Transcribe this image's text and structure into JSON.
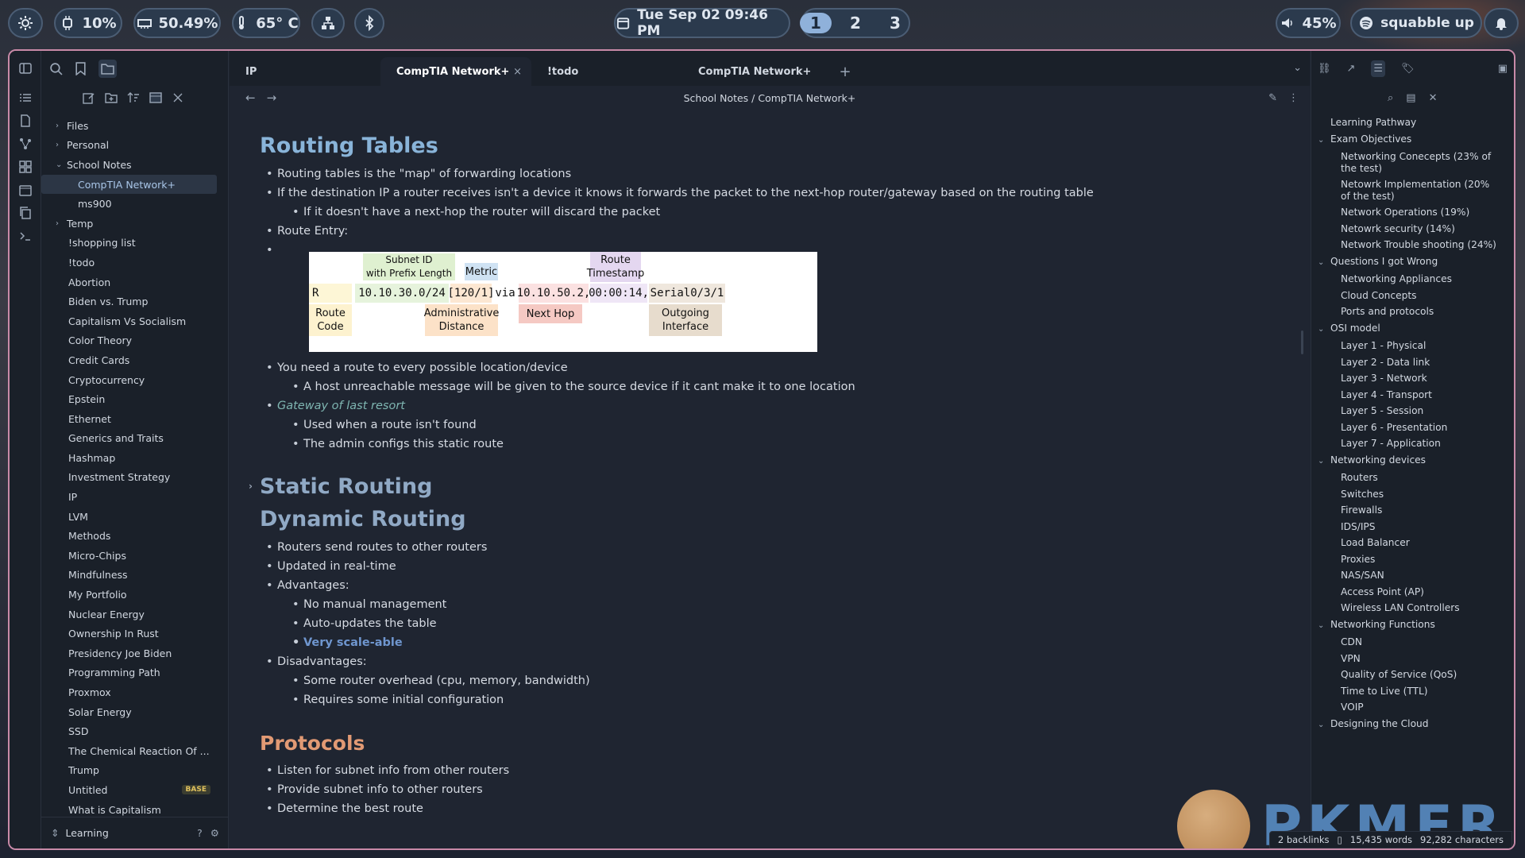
{
  "topbar": {
    "cpu": "10%",
    "memory": "50.49%",
    "temp": "65° C",
    "datetime": "Tue Sep 02  09:46 PM",
    "workspaces": [
      "1",
      "2",
      "3"
    ],
    "volume": "45%",
    "music": "squabble up"
  },
  "tabs": [
    {
      "label": "IP"
    },
    {
      "label": "CompTIA Network+",
      "close": "×"
    },
    {
      "label": "!todo"
    },
    {
      "label": "CompTIA Network+"
    }
  ],
  "breadcrumb": "School Notes / CompTIA Network+",
  "filetree": [
    {
      "label": "Files",
      "type": "folder",
      "chevron": "›"
    },
    {
      "label": "Personal",
      "type": "folder",
      "chevron": "›"
    },
    {
      "label": "School Notes",
      "type": "folder",
      "chevron": "⌄"
    },
    {
      "label": "CompTIA Network+",
      "type": "child-active"
    },
    {
      "label": "ms900",
      "type": "child"
    },
    {
      "label": "Temp",
      "type": "folder",
      "chevron": "›"
    },
    {
      "label": "!shopping list"
    },
    {
      "label": "!todo"
    },
    {
      "label": "Abortion"
    },
    {
      "label": "Biden vs. Trump"
    },
    {
      "label": "Capitalism Vs Socialism"
    },
    {
      "label": "Color Theory"
    },
    {
      "label": "Credit Cards"
    },
    {
      "label": "Cryptocurrency"
    },
    {
      "label": "Epstein"
    },
    {
      "label": "Ethernet"
    },
    {
      "label": "Generics and Traits"
    },
    {
      "label": "Hashmap"
    },
    {
      "label": "Investment Strategy"
    },
    {
      "label": "IP"
    },
    {
      "label": "LVM"
    },
    {
      "label": "Methods"
    },
    {
      "label": "Micro-Chips"
    },
    {
      "label": "Mindfulness"
    },
    {
      "label": "My Portfolio"
    },
    {
      "label": "Nuclear Energy"
    },
    {
      "label": "Ownership In Rust"
    },
    {
      "label": "Presidency Joe Biden"
    },
    {
      "label": "Programming Path"
    },
    {
      "label": "Proxmox"
    },
    {
      "label": "Solar Energy"
    },
    {
      "label": "SSD"
    },
    {
      "label": "The Chemical Reaction Of ..."
    },
    {
      "label": "Trump"
    },
    {
      "label": "Untitled",
      "badge": "BASE"
    },
    {
      "label": "What is Capitalism"
    }
  ],
  "vault": "Learning",
  "note": {
    "h_routing": "Routing Tables",
    "routing": [
      {
        "t": "Routing tables is the \"map\" of forwarding locations",
        "l": 1
      },
      {
        "t": "If the destination IP a router receives isn't a device it knows it forwards the packet to the next-hop router/gateway based on the routing table",
        "l": 1
      },
      {
        "t": "If it doesn't have a next-hop the router will discard the packet",
        "l": 2
      },
      {
        "t": "Route Entry:",
        "l": 1
      }
    ],
    "route_entry": {
      "subnet_label": "Subnet ID\nwith Prefix Length",
      "metric_label": "Metric",
      "timestamp_label": "Route\nTimestamp",
      "code": "R",
      "subnet": "10.10.30.0/24",
      "admin": "[120/1]",
      "via": "via",
      "nexthop": "10.10.50.2,",
      "time": "00:00:14,",
      "iface": "Serial0/3/1",
      "route_code_label": "Route\nCode",
      "admin_label": "Administrative\nDistance",
      "nexthop_label": "Next Hop",
      "iface_label": "Outgoing\nInterface"
    },
    "routing2": [
      {
        "t": "You need a route to every possible location/device",
        "l": 1
      },
      {
        "t": "A host unreachable message will be given to the source device if it cant make it to one location",
        "l": 2
      },
      {
        "t": "Gateway of last resort",
        "l": 1,
        "s": "italic"
      },
      {
        "t": "Used when a route isn't found",
        "l": 2
      },
      {
        "t": "The admin configs this static route",
        "l": 2
      }
    ],
    "h_static": "Static Routing",
    "h_dynamic": "Dynamic Routing",
    "dynamic": [
      {
        "t": "Routers send routes to other routers",
        "l": 1
      },
      {
        "t": "Updated in real-time",
        "l": 1
      },
      {
        "t": "Advantages:",
        "l": 1
      },
      {
        "t": "No manual management",
        "l": 2
      },
      {
        "t": "Auto-updates the table",
        "l": 2
      },
      {
        "t": "Very scale-able",
        "l": 2,
        "s": "bold-link"
      },
      {
        "t": "Disadvantages:",
        "l": 1
      },
      {
        "t": "Some router overhead (cpu, memory, bandwidth)",
        "l": 2
      },
      {
        "t": "Requires some initial configuration",
        "l": 2
      }
    ],
    "h_protocols": "Protocols",
    "protocols": [
      {
        "t": "Listen for subnet info from other routers",
        "l": 1
      },
      {
        "t": "Provide subnet info to other routers",
        "l": 1
      },
      {
        "t": "Determine the best route",
        "l": 1
      }
    ]
  },
  "outline": [
    {
      "t": "Learning Pathway",
      "k": "top"
    },
    {
      "t": "Exam Objectives",
      "k": "h"
    },
    {
      "t": "Networking Conecepts (23% of the test)",
      "k": "sub"
    },
    {
      "t": "Netowrk Implementation (20% of the test)",
      "k": "sub"
    },
    {
      "t": "Network Operations (19%)",
      "k": "sub"
    },
    {
      "t": "Netowrk security (14%)",
      "k": "sub"
    },
    {
      "t": "Network Trouble shooting (24%)",
      "k": "sub"
    },
    {
      "t": "Questions I got Wrong",
      "k": "h"
    },
    {
      "t": "Networking Appliances",
      "k": "sub"
    },
    {
      "t": "Cloud Concepts",
      "k": "sub"
    },
    {
      "t": "Ports and protocols",
      "k": "sub"
    },
    {
      "t": "OSI model",
      "k": "h"
    },
    {
      "t": "Layer 1 - Physical",
      "k": "sub"
    },
    {
      "t": "Layer 2 - Data link",
      "k": "sub"
    },
    {
      "t": "Layer 3 - Network",
      "k": "sub"
    },
    {
      "t": "Layer 4 - Transport",
      "k": "sub"
    },
    {
      "t": "Layer 5 - Session",
      "k": "sub"
    },
    {
      "t": "Layer 6 - Presentation",
      "k": "sub"
    },
    {
      "t": "Layer 7 - Application",
      "k": "sub"
    },
    {
      "t": "Networking devices",
      "k": "h"
    },
    {
      "t": "Routers",
      "k": "sub"
    },
    {
      "t": "Switches",
      "k": "sub"
    },
    {
      "t": "Firewalls",
      "k": "sub"
    },
    {
      "t": "IDS/IPS",
      "k": "sub"
    },
    {
      "t": "Load Balancer",
      "k": "sub"
    },
    {
      "t": "Proxies",
      "k": "sub"
    },
    {
      "t": "NAS/SAN",
      "k": "sub"
    },
    {
      "t": "Access Point (AP)",
      "k": "sub"
    },
    {
      "t": "Wireless LAN Controllers",
      "k": "sub"
    },
    {
      "t": "Networking Functions",
      "k": "h"
    },
    {
      "t": "CDN",
      "k": "sub"
    },
    {
      "t": "VPN",
      "k": "sub"
    },
    {
      "t": "Quality of Service (QoS)",
      "k": "sub"
    },
    {
      "t": "Time to Live (TTL)",
      "k": "sub"
    },
    {
      "t": "VOIP",
      "k": "sub"
    },
    {
      "t": "Designing the Cloud",
      "k": "h"
    }
  ],
  "status": {
    "backlinks": "2 backlinks",
    "words": "15,435 words",
    "chars": "92,282 characters"
  },
  "watermark": "PKMER",
  "colors": {
    "accent": "#89b4d9",
    "border": "#c98aa8",
    "protocols": "#e29a74"
  }
}
